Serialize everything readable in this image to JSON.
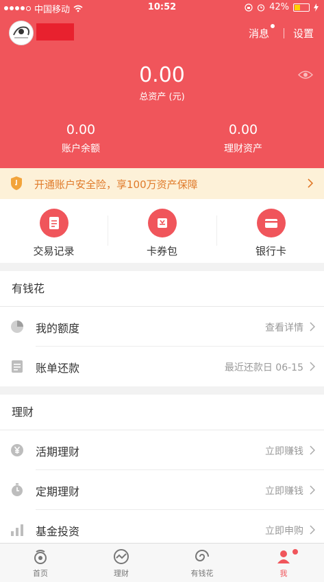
{
  "status_bar": {
    "carrier": "中国移动",
    "time": "10:52",
    "battery": "42%",
    "battery_level": 0.42
  },
  "header": {
    "messages_label": "消息",
    "settings_label": "设置",
    "total_assets_value": "0.00",
    "total_assets_label": "总资产 (元)",
    "balance_value": "0.00",
    "balance_label": "账户余额",
    "wealth_value": "0.00",
    "wealth_label": "理财资产"
  },
  "banner": {
    "text": "开通账户安全险，享100万资产保障"
  },
  "quick_actions": [
    {
      "label": "交易记录",
      "icon": "receipt-icon"
    },
    {
      "label": "卡券包",
      "icon": "coupon-icon"
    },
    {
      "label": "银行卡",
      "icon": "bank-card-icon"
    }
  ],
  "youqianhua": {
    "title": "有钱花",
    "rows": [
      {
        "label": "我的额度",
        "value": "查看详情",
        "icon": "pie-chart-icon"
      },
      {
        "label": "账单还款",
        "value": "最近还款日 06-15",
        "icon": "bill-icon"
      }
    ]
  },
  "licai": {
    "title": "理财",
    "rows": [
      {
        "label": "活期理财",
        "value": "立即赚钱",
        "icon": "yen-icon"
      },
      {
        "label": "定期理财",
        "value": "立即赚钱",
        "icon": "timer-icon"
      },
      {
        "label": "基金投资",
        "value": "立即申购",
        "icon": "bar-chart-icon"
      }
    ]
  },
  "tabbar": {
    "tabs": [
      {
        "label": "首页",
        "icon": "home-icon"
      },
      {
        "label": "理财",
        "icon": "wealth-icon"
      },
      {
        "label": "有钱花",
        "icon": "spiral-icon"
      },
      {
        "label": "我",
        "icon": "user-icon",
        "active": true
      }
    ]
  },
  "colors": {
    "brand": "#f0555b",
    "banner_bg": "#fdf1d8",
    "banner_text": "#e07a2a"
  }
}
